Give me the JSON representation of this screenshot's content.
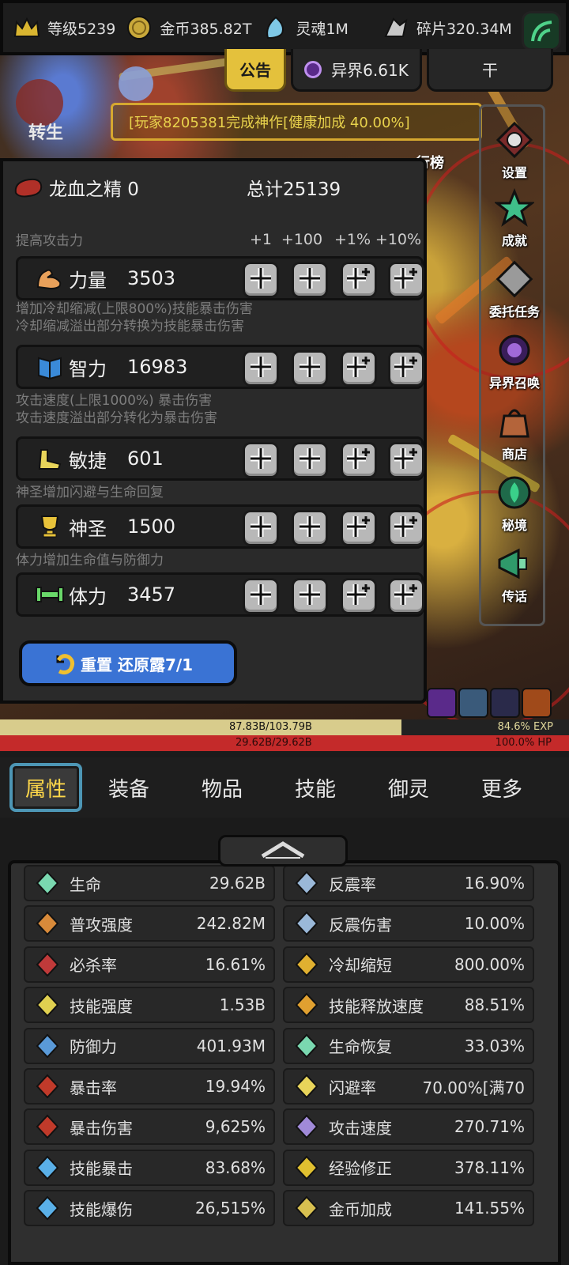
{
  "topbar": {
    "resources": [
      {
        "icon": "crown-icon",
        "value": "等级5239"
      },
      {
        "icon": "gold-coin-icon",
        "value": "金币385.82T"
      },
      {
        "icon": "soul-icon",
        "value": "灵魂1M"
      },
      {
        "icon": "shard-icon",
        "value": "碎片320.34M"
      }
    ]
  },
  "subtabs": {
    "announcement": "公告",
    "otherworld": "异界6.61K",
    "third": "干"
  },
  "ticker": "[玩家8205381完成神作[健康加成 40.00%]",
  "reborn_label": "转生",
  "rank_label": "行榜",
  "side_menu": [
    {
      "icon": "settings-gear-icon",
      "label": "设置"
    },
    {
      "icon": "star-icon",
      "label": "成就"
    },
    {
      "icon": "quest-scroll-icon",
      "label": "委托任务"
    },
    {
      "icon": "portal-icon",
      "label": "异界召唤"
    },
    {
      "icon": "shop-bag-icon",
      "label": "商店"
    },
    {
      "icon": "secret-realm-icon",
      "label": "秘境"
    },
    {
      "icon": "megaphone-icon",
      "label": "传话"
    }
  ],
  "panel": {
    "currency_name": "龙血之精 0",
    "total": "总计25139",
    "section_hint": "提高攻击力",
    "increments": [
      "+1",
      "+100",
      "+1%",
      "+10%"
    ],
    "stats": [
      {
        "name": "力量",
        "value": "3503",
        "desc": [
          "提高攻击力"
        ]
      },
      {
        "name": "智力",
        "value": "16983",
        "desc": [
          "增加冷却缩减(上限800%)技能暴击伤害",
          "冷却缩减溢出部分转换为技能暴击伤害"
        ]
      },
      {
        "name": "敏捷",
        "value": "601",
        "desc": [
          "攻击速度(上限1000%) 暴击伤害",
          "攻击速度溢出部分转化为暴击伤害"
        ]
      },
      {
        "name": "神圣",
        "value": "1500",
        "desc": [
          "神圣增加闪避与生命回复"
        ]
      },
      {
        "name": "体力",
        "value": "3457",
        "desc": [
          "体力增加生命值与防御力"
        ]
      }
    ],
    "reset_label": "重置 还原露7/1"
  },
  "bars": {
    "exp_text": "87.83B/103.79B",
    "exp_pct": "84.6% EXP",
    "exp_fraction": 0.846,
    "hp_text": "29.62B/29.62B",
    "hp_pct": "100.0%  HP",
    "hp_fraction": 1.0
  },
  "nav": [
    "属性",
    "装备",
    "物品",
    "技能",
    "御灵",
    "更多"
  ],
  "attributes": [
    {
      "name": "生命",
      "value": "29.62B",
      "icon": "life-cross-icon"
    },
    {
      "name": "反震率",
      "value": "16.90%",
      "icon": "shatter-icon"
    },
    {
      "name": "普攻强度",
      "value": "242.82M",
      "icon": "sword-icon"
    },
    {
      "name": "反震伤害",
      "value": "10.00%",
      "icon": "shatter-damage-icon"
    },
    {
      "name": "必杀率",
      "value": "16.61%",
      "icon": "kill-icon"
    },
    {
      "name": "冷却缩短",
      "value": "800.00%",
      "icon": "cooldown-icon"
    },
    {
      "name": "技能强度",
      "value": "1.53B",
      "icon": "lightning-icon"
    },
    {
      "name": "技能释放速度",
      "value": "88.51%",
      "icon": "cast-speed-icon"
    },
    {
      "name": "防御力",
      "value": "401.93M",
      "icon": "shield-icon"
    },
    {
      "name": "生命恢复",
      "value": "33.03%",
      "icon": "regen-icon"
    },
    {
      "name": "暴击率",
      "value": "19.94%",
      "icon": "crit-claw-icon"
    },
    {
      "name": "闪避率",
      "value": "70.00%[满70",
      "icon": "winged-boot-icon"
    },
    {
      "name": "暴击伤害",
      "value": "9,625%",
      "icon": "crit-damage-icon"
    },
    {
      "name": "攻击速度",
      "value": "270.71%",
      "icon": "attack-speed-icon"
    },
    {
      "name": "技能暴击",
      "value": "83.68%",
      "icon": "skill-crit-flame-icon"
    },
    {
      "name": "经验修正",
      "value": "378.11%",
      "icon": "exp-crown-icon"
    },
    {
      "name": "技能爆伤",
      "value": "26,515%",
      "icon": "skill-burst-flame-icon"
    },
    {
      "name": "金币加成",
      "value": "141.55%",
      "icon": "gold-bonus-icon"
    }
  ]
}
